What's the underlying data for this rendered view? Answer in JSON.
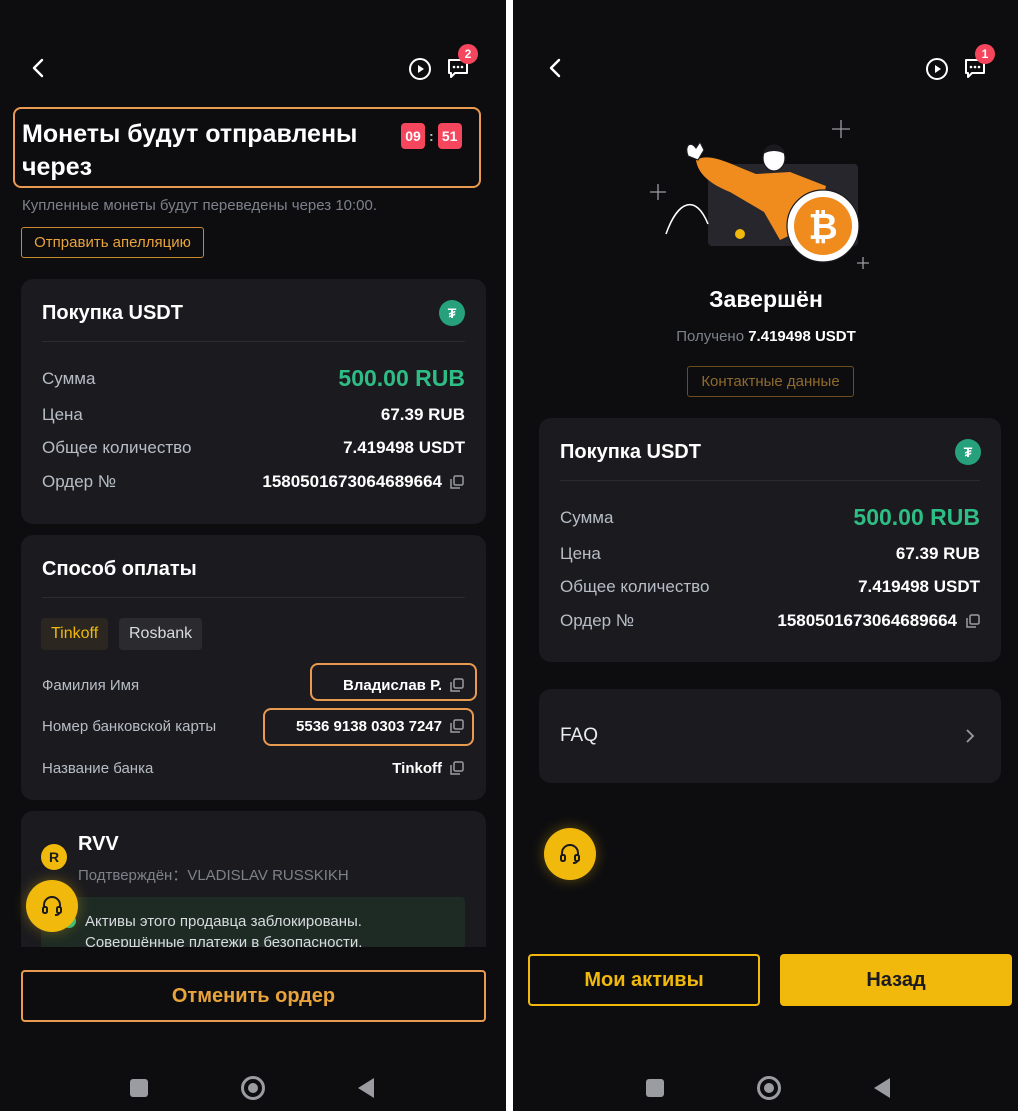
{
  "left": {
    "unread_count": "2",
    "heading": "Монеты будут отправлены через",
    "timer": {
      "minutes": "09",
      "separator": ":",
      "seconds": "51"
    },
    "subtitle": "Купленные монеты будут переведены через 10:00.",
    "appeal_button": "Отправить апелляцию",
    "order_card": {
      "title": "Покупка USDT",
      "token_glyph": "₮",
      "rows": [
        {
          "label": "Сумма",
          "value": "500.00 RUB"
        },
        {
          "label": "Цена",
          "value": "67.39 RUB"
        },
        {
          "label": "Общее количество",
          "value": "7.419498 USDT"
        },
        {
          "label": "Ордер №",
          "value": "1580501673064689664"
        }
      ]
    },
    "payment_card": {
      "title": "Способ оплаты",
      "methods": [
        "Tinkoff",
        "Rosbank"
      ],
      "rows": [
        {
          "label": "Фамилия Имя",
          "value": "Владислав Р."
        },
        {
          "label": "Номер банковской карты",
          "value": "5536 9138 0303 7247"
        },
        {
          "label": "Название банка",
          "value": "Tinkoff"
        }
      ]
    },
    "seller": {
      "avatar_letter": "R",
      "name": "RVV",
      "verified": "Подтверждён：VLADISLAV RUSSKIKH",
      "notice_line1": "Активы этого продавца заблокированы.",
      "notice_line2": "Совершённые платежи в безопасности."
    },
    "cancel_button": "Отменить ордер"
  },
  "right": {
    "unread_count": "1",
    "status": "Завершён",
    "received_label": "Получено",
    "received_value": "7.419498 USDT",
    "contact_button": "Контактные данные",
    "order_card": {
      "title": "Покупка USDT",
      "token_glyph": "₮",
      "rows": [
        {
          "label": "Сумма",
          "value": "500.00 RUB"
        },
        {
          "label": "Цена",
          "value": "67.39 RUB"
        },
        {
          "label": "Общее количество",
          "value": "7.419498 USDT"
        },
        {
          "label": "Ордер №",
          "value": "1580501673064689664"
        }
      ]
    },
    "faq_label": "FAQ",
    "my_assets_button": "Мои активы",
    "back_button": "Назад"
  },
  "colors": {
    "background": "#0d0d10",
    "card": "#1b1b1f",
    "accent": "#f0b90b",
    "highlight_outline": "#e89a51",
    "positive": "#2ebd85",
    "badge": "#f6465d",
    "tether": "#26a17b"
  },
  "icons": [
    "back-arrow-icon",
    "play-circle-icon",
    "chat-icon",
    "copy-icon",
    "tether-icon",
    "headset-icon",
    "chevron-right-icon",
    "check-circle-icon",
    "nav-recents-icon",
    "nav-home-icon",
    "nav-back-icon",
    "bitcoin-illustration"
  ]
}
